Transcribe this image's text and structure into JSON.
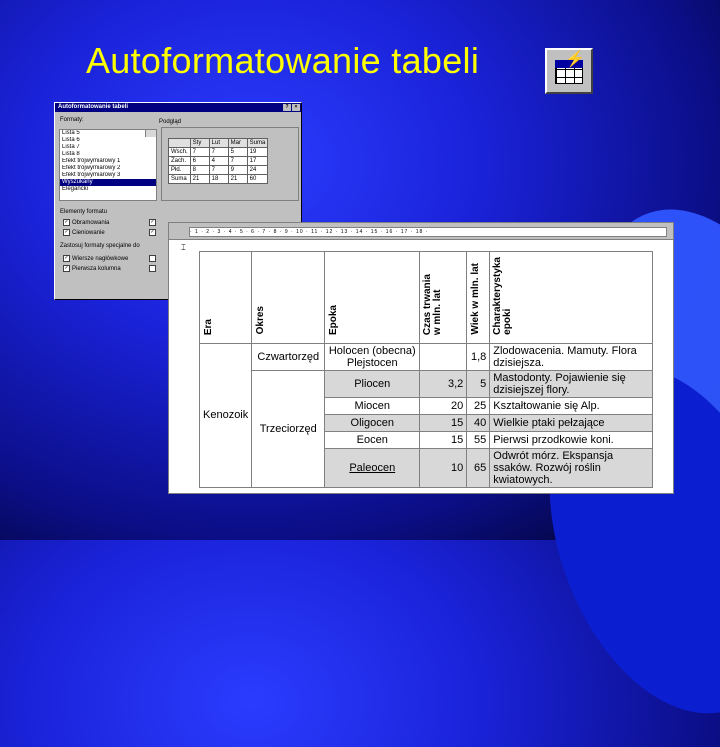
{
  "slide": {
    "title": "Autoformatowanie tabeli"
  },
  "toolbar": {
    "autoformat_icon": "table-autoformat-icon"
  },
  "dialog": {
    "title": "Autoformatowanie tabeli",
    "help": "?",
    "close": "×",
    "formats_label": "Formaty:",
    "preview_label": "Podgląd",
    "formats": [
      "Lista 5",
      "Lista 6",
      "Lista 7",
      "Lista 8",
      "Efekt trójwymiarowy 1",
      "Efekt trójwymiarowy 2",
      "Efekt trójwymiarowy 3",
      "Wyszukany",
      "Elegancki"
    ],
    "selected_index": 7,
    "preview_table": [
      [
        "",
        "Sty",
        "Lut",
        "Mar",
        "Suma"
      ],
      [
        "Wsch.",
        "7",
        "7",
        "5",
        "19"
      ],
      [
        "Zach.",
        "6",
        "4",
        "7",
        "17"
      ],
      [
        "Płd.",
        "8",
        "7",
        "9",
        "24"
      ],
      [
        "Suma",
        "21",
        "18",
        "21",
        "60"
      ]
    ],
    "apply_formats_label": "Elementy formatu",
    "apply_special_label": "Zastosuj formaty specjalne do",
    "checks_formats": [
      "Obramowania",
      "Cieniowanie"
    ],
    "checks_special": [
      "Wiersze nagłówkowe",
      "Pierwsza kolumna"
    ]
  },
  "ruler": {
    "text": "· 1 · 2 · 3 · 4 · 5 · 6 · 7 · 8 · 9 · 10 · 11 · 12 · 13 · 14 · 15 · 16 · 17 · 18 ·"
  },
  "doc_table": {
    "headers": [
      "Era",
      "Okres",
      "Epoka",
      "Czas trwania\nw mln. lat",
      "Wiek w mln. lat",
      "Charakterystyka\nepoki"
    ],
    "era": "Kenozoik",
    "period_q": "Czwartorzęd",
    "period_t": "Trzeciorzęd",
    "rows": [
      {
        "epoch": "Holocen (obecna) Plejstocen",
        "dur": "",
        "age": "1,8",
        "desc": "Zlodowacenia. Mamuty. Flora dzisiejsza."
      },
      {
        "epoch": "Pliocen",
        "dur": "3,2",
        "age": "5",
        "desc": "Mastodonty. Pojawienie się dzisiejszej flory."
      },
      {
        "epoch": "Miocen",
        "dur": "20",
        "age": "25",
        "desc": "Kształtowanie się Alp."
      },
      {
        "epoch": "Oligocen",
        "dur": "15",
        "age": "40",
        "desc": "Wielkie ptaki pełzające"
      },
      {
        "epoch": "Eocen",
        "dur": "15",
        "age": "55",
        "desc": "Pierwsi przodkowie koni."
      },
      {
        "epoch": "Paleocen",
        "dur": "10",
        "age": "65",
        "desc": "Odwrót mórz. Ekspansja ssaków. Rozwój roślin kwiatowych."
      }
    ]
  }
}
